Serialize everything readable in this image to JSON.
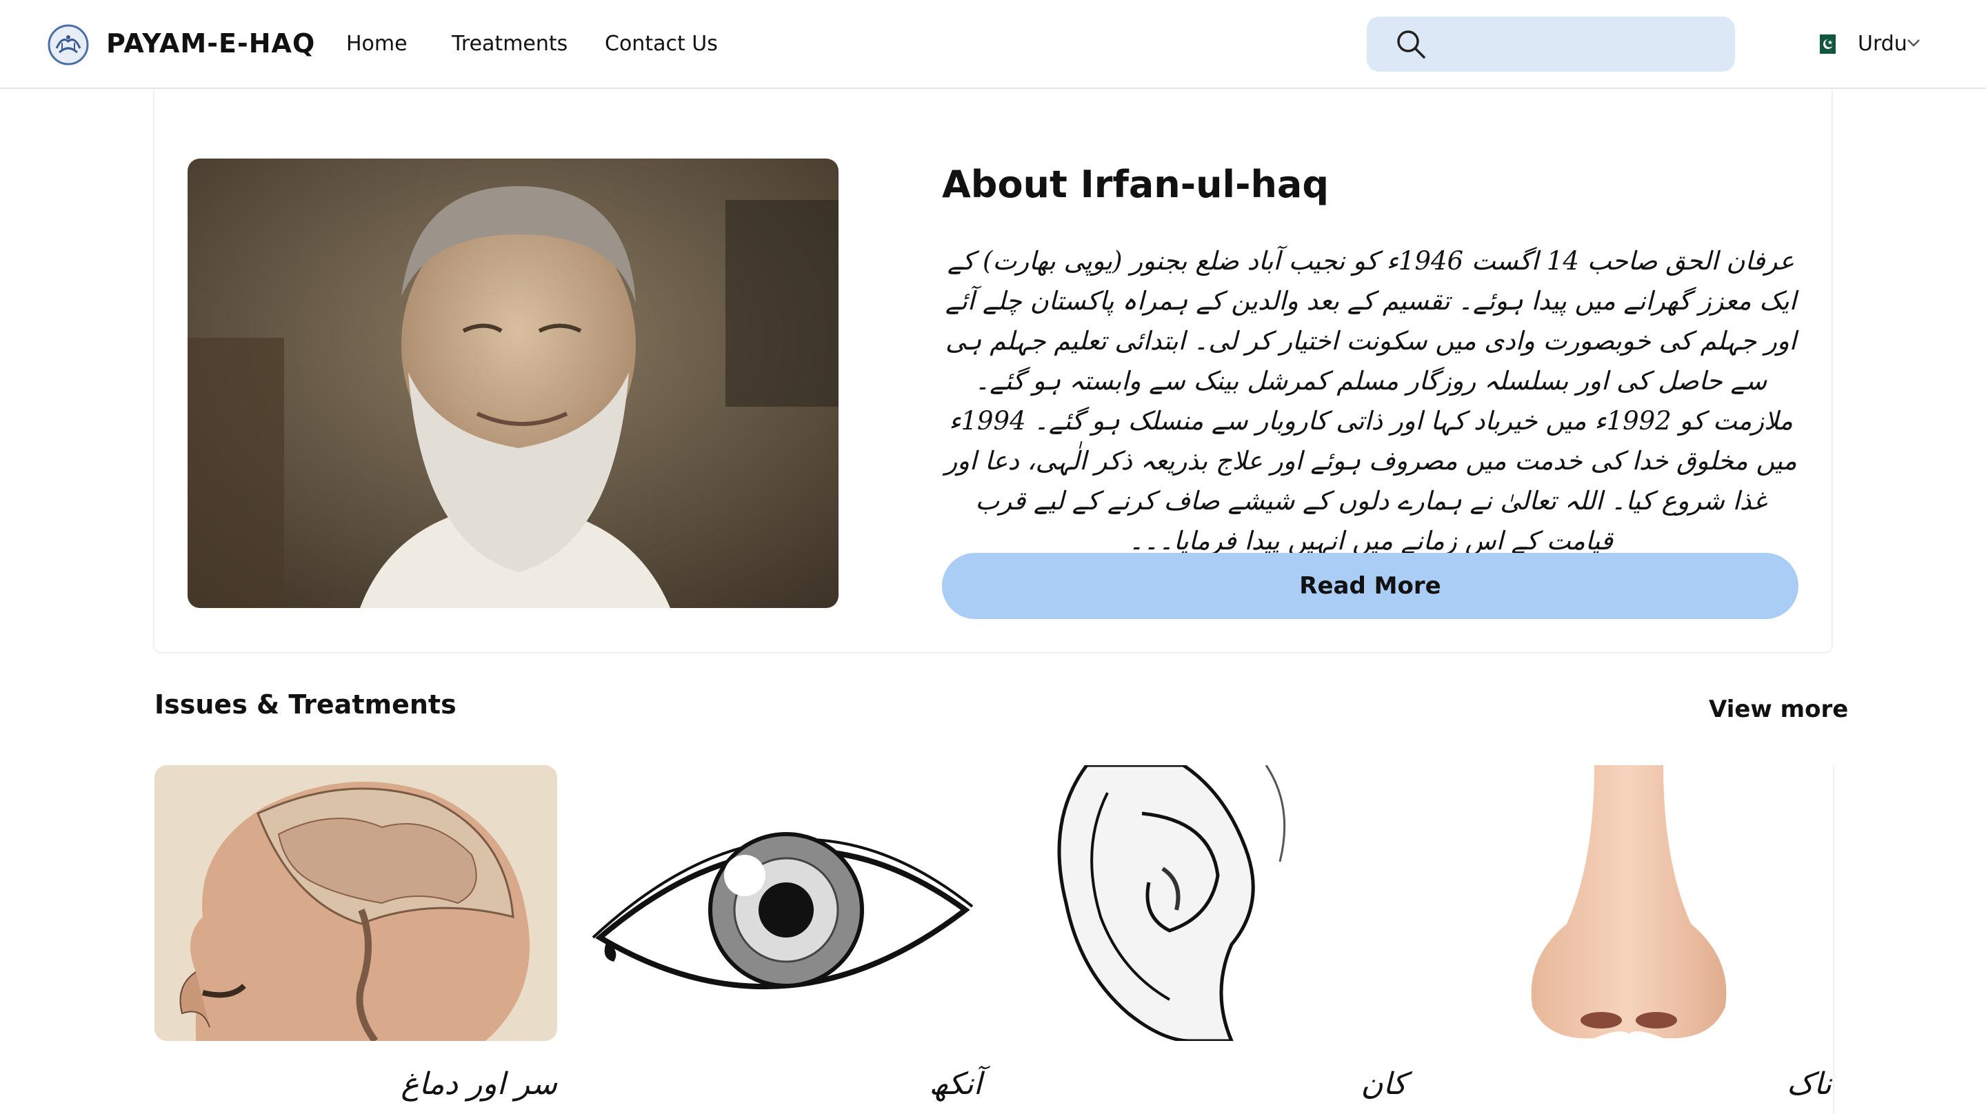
{
  "header": {
    "brand": "PAYAM-E-HAQ",
    "nav": [
      {
        "label": "Home"
      },
      {
        "label": "Treatments"
      },
      {
        "label": "Contact Us"
      }
    ],
    "search": {
      "placeholder": "",
      "value": ""
    },
    "language": {
      "selected": "Urdu",
      "flag_icon": "pakistan-flag-icon"
    }
  },
  "about": {
    "title": "About Irfan-ul-haq",
    "text": "عرفان الحق صاحب 14 اگست 1946ء کو نجیب آباد ضلع بجنور (یوپی بھارت) کے ایک معزز گھرانے میں پیدا ہوئے۔ تقسیم کے بعد والدین کے ہمراہ پاکستان چلے آئے اور جہلم کی خوبصورت وادی میں سکونت اختیار کر لی۔ ابتدائی تعلیم جہلم ہی سے حاصل کی اور بسلسلہ روزگار مسلم کمرشل بینک سے وابستہ ہو گئے۔ ملازمت کو 1992ء میں خیرباد کہا اور ذاتی کاروبار سے منسلک ہو گئے۔ 1994ء میں مخلوق خدا کی خدمت میں مصروف ہوئے اور علاج بذریعہ ذکر الٰہی، دعا اور غذا شروع کیا۔ اللہ تعالیٰ نے ہمارے دلوں کے شیشے صاف کرنے کے لیے قرب قیامت کے اس زمانے میں انہیں پیدا فرمایا۔۔۔",
    "button": "Read More"
  },
  "issues": {
    "title": "Issues & Treatments",
    "view_more": "View more",
    "items": [
      {
        "label": "سر اور دماغ",
        "image": "head-brain-illustration"
      },
      {
        "label": "آنکھ",
        "image": "eye-illustration"
      },
      {
        "label": "کان",
        "image": "ear-illustration"
      },
      {
        "label": "ناک",
        "image": "nose-illustration"
      }
    ]
  },
  "colors": {
    "search_bg": "#dde8f6",
    "button_bg": "#a9cdf4",
    "border": "#e6e6e6"
  }
}
